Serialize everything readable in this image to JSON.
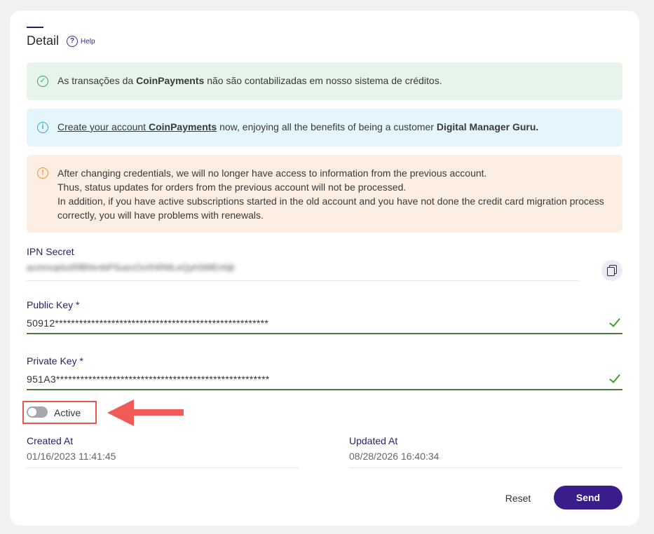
{
  "header": {
    "title": "Detail",
    "help_label": "Help"
  },
  "alerts": {
    "success": {
      "icon": "check-circle-icon",
      "pre": "As transações da ",
      "bold": "CoinPayments",
      "post": " não são contabilizadas em nosso sistema de créditos."
    },
    "info": {
      "icon": "info-circle-icon",
      "link_pre": "Create your account ",
      "link_bold": "CoinPayments",
      "mid": " now, enjoying all the benefits of being a customer ",
      "bold_end": "Digital Manager Guru."
    },
    "warning": {
      "icon": "warning-circle-icon",
      "line1": "After changing credentials, we will no longer have access to information from the previous account.",
      "line2": "Thus, status updates for orders from the previous account will not be processed.",
      "line3": "In addition, if you have active subscriptions started in the old account and you have not done the credit card migration process correctly, you will have problems with renewals."
    }
  },
  "fields": {
    "ipn_secret": {
      "label": "IPN Secret",
      "value": "acmnvqrkzt5f8hlvnbPSuecOxXhRMLeQyhSMEnhjk"
    },
    "public_key": {
      "label": "Public Key *",
      "value": "50912*****************************************************"
    },
    "private_key": {
      "label": "Private Key *",
      "value": "951A3*****************************************************"
    }
  },
  "toggle": {
    "label": "Active",
    "state": "off"
  },
  "meta": {
    "created_label": "Created At",
    "created_value": "01/16/2023 11:41:45",
    "updated_label": "Updated At",
    "updated_value": "08/28/2026 16:40:34"
  },
  "actions": {
    "reset_label": "Reset",
    "send_label": "Send"
  },
  "colors": {
    "primary": "#3a1d8a",
    "annotation": "#f05a57",
    "success": "#4c9a3c"
  }
}
